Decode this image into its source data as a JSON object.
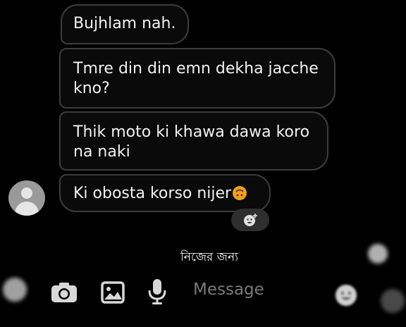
{
  "messages": [
    {
      "text": "Bujhlam nah."
    },
    {
      "text": "Tmre din din emn dekha jacche kno?"
    },
    {
      "text": "Thik moto ki khawa dawa koro na naki"
    },
    {
      "text": "Ki obosta korso nijer",
      "emoji": "upside-down-face"
    }
  ],
  "sender": {
    "avatar_icon": "person-icon"
  },
  "reaction_button": {
    "icon": "add-emoji-icon"
  },
  "caption": "নিজের জন্য",
  "composer": {
    "placeholder": "Message",
    "icons": [
      "camera-icon",
      "gallery-icon",
      "microphone-icon"
    ]
  },
  "colors": {
    "background": "#000000",
    "bubble_border": "#3c3c3c",
    "placeholder": "#7a7a7a"
  }
}
